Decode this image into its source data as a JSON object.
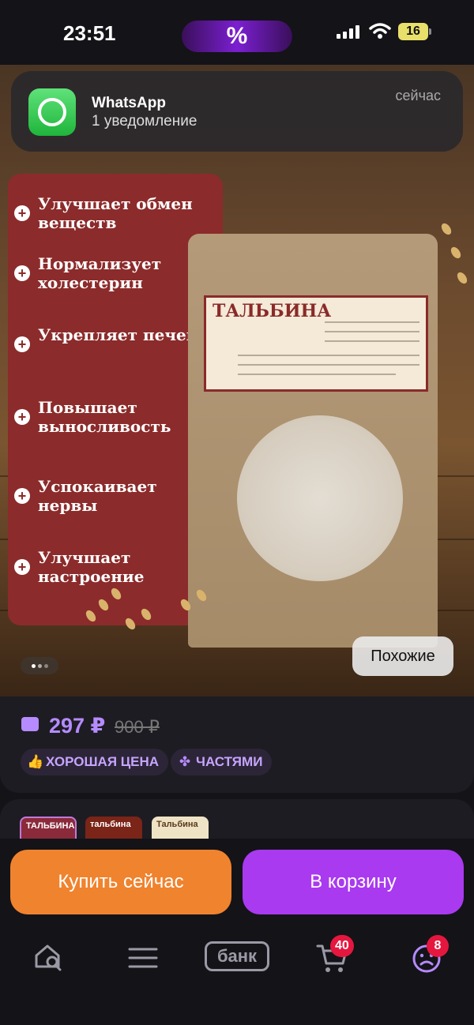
{
  "status_bar": {
    "time": "23:51",
    "promo_symbol": "%",
    "battery": "16"
  },
  "notification": {
    "app": "WhatsApp",
    "text": "1 уведомление",
    "time": "сейчас"
  },
  "product": {
    "benefits": [
      "Улучшает обмен веществ",
      "Нормализует холестерин",
      "Укрепляет печень",
      "Повышает выносливость",
      "Успокаивает нервы",
      "Улучшает настроение"
    ],
    "package_title": "ТАЛЬБИНА",
    "similar_label": "Похожие"
  },
  "price": {
    "current": "297 ₽",
    "old": "900 ₽",
    "chips": [
      {
        "label": "ХОРОШАЯ ЦЕНА",
        "icon": "thumbs-up-icon"
      },
      {
        "label": "ЧАСТЯМИ",
        "icon": "clover-icon"
      }
    ]
  },
  "thumbnails": [
    {
      "caption": "ТАЛЬБИНА"
    },
    {
      "caption": "тальбина"
    },
    {
      "caption": "Тальбина"
    }
  ],
  "actions": {
    "buy_now": "Купить сейчас",
    "add_to_cart": "В корзину"
  },
  "bottom_nav": {
    "bank_label": "банк",
    "cart_badge": "40",
    "profile_badge": "8"
  }
}
